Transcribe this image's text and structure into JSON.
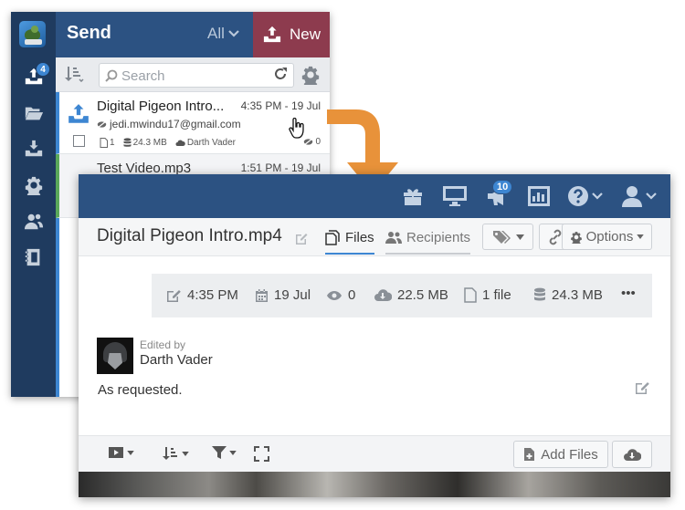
{
  "back": {
    "header": {
      "title": "Send",
      "filter": "All",
      "new_label": "New"
    },
    "rail": {
      "upload_badge": "4"
    },
    "search": {
      "placeholder": "Search"
    },
    "rows": [
      {
        "name": "Digital Pigeon Intro...",
        "email": "jedi.mwindu17@gmail.com",
        "time": "4:35 PM - 19 Jul",
        "files": "1",
        "size": "24.3 MB",
        "owner": "Darth Vader",
        "views": "0"
      },
      {
        "name": "Test Video.mp3",
        "time": "1:51 PM - 19 Jul"
      }
    ]
  },
  "front": {
    "topbar": {
      "notification_count": "10"
    },
    "title": "Digital Pigeon Intro.mp4",
    "tabs": {
      "files": "Files",
      "recipients": "Recipients"
    },
    "options_label": "Options",
    "stats": {
      "time": "4:35 PM",
      "date": "19 Jul",
      "views": "0",
      "downloaded": "22.5 MB",
      "files": "1 file",
      "size": "24.3 MB",
      "more": "•••"
    },
    "comment": {
      "edited_by_label": "Edited by",
      "author": "Darth Vader",
      "text": "As requested."
    },
    "player": {
      "add_files_label": "Add Files"
    }
  },
  "colors": {
    "navy": "#1f3b5f",
    "header_blue": "#2c5282",
    "new_button": "#8d3b4e",
    "accent_blue": "#3d86d2",
    "arrow_orange": "#e8923a",
    "green_status": "#5aa85a"
  }
}
